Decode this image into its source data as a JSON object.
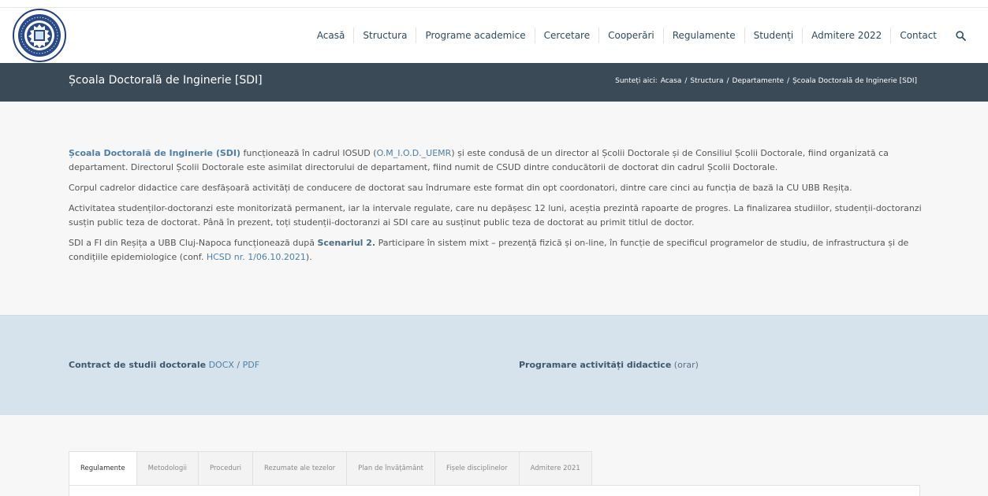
{
  "colors": {
    "title_bar": "#3b4a57",
    "nav_text": "#2e4a5e",
    "link": "#4f7fa6",
    "band": "#d7e3ec",
    "body_bg": "#f7f7f7"
  },
  "nav": {
    "items": [
      {
        "label": "Acasă"
      },
      {
        "label": "Structura"
      },
      {
        "label": "Programe academice"
      },
      {
        "label": "Cercetare"
      },
      {
        "label": "Cooperări"
      },
      {
        "label": "Regulamente"
      },
      {
        "label": "Studenți"
      },
      {
        "label": "Admitere 2022"
      },
      {
        "label": "Contact"
      }
    ],
    "search_icon": "search-icon"
  },
  "title_bar": {
    "page_title": "Școala Doctorală de Inginerie [SDI]",
    "breadcrumb": {
      "prefix": "Sunteți aici:",
      "items": [
        "Acasa",
        "Structura",
        "Departamente",
        "Școala Doctorală de Inginerie [SDI]"
      ],
      "separator": "/"
    }
  },
  "content": {
    "p1": {
      "link1": "Școala Doctorală de Inginerie (SDI)",
      "text1": " funcționează în cadrul IOSUD (",
      "link2": "O.M_I.O.D._UEMR",
      "text2": ") și este condusă de un director al Școlii Doctorale și de Consiliul Școlii Doctorale, fiind organizată ca departament. Directorul Școlii Doctorale este asimilat directorului de departament, fiind numit de CSUD dintre conducătorii de doctorat din cadrul Școlii Doctorale."
    },
    "p2": "Corpul cadrelor didactice care desfășoară activități de conducere de doctorat sau îndrumare este format din opt coordonatori, dintre care cinci au funcția de bază la CU UBB Reșița.",
    "p3": "Activitatea studenților-doctoranzi este monitorizată permanent, iar la intervale regulate, care nu depășesc 12 luni, aceștia prezintă rapoarte de progres. La finalizarea studiilor, studenții-doctoranzi susțin public teza de doctorat. Până în prezent, toți studenții-doctoranzi ai SDI care au susținut public teza de doctorat au primit titlul de doctor.",
    "p4": {
      "text1": "SDI a FI din Reșița a UBB Cluj-Napoca funcționează după ",
      "strong": "Scenariul 2.",
      "text2": " Participare în sistem mixt – prezență fizică și on-line, în funcție de specificul programelor de studiu, de infrastructura și de condițiile epidemiologice (conf. ",
      "link": "HCSD nr. 1/06.10.2021",
      "text3": ")."
    }
  },
  "band": {
    "left": {
      "title": "Contract de studii doctorale",
      "docx": "DOCX",
      "slash": " / ",
      "pdf": "PDF"
    },
    "right": {
      "title": "Programare activități didactice",
      "orar": "(orar)"
    }
  },
  "tabs": [
    {
      "label": "Regulamente",
      "active": true
    },
    {
      "label": "Metodologii"
    },
    {
      "label": "Proceduri"
    },
    {
      "label": "Rezumate ale tezelor"
    },
    {
      "label": "Plan de învățământ"
    },
    {
      "label": "Fișele disciplinelor"
    },
    {
      "label": "Admitere 2021"
    }
  ]
}
